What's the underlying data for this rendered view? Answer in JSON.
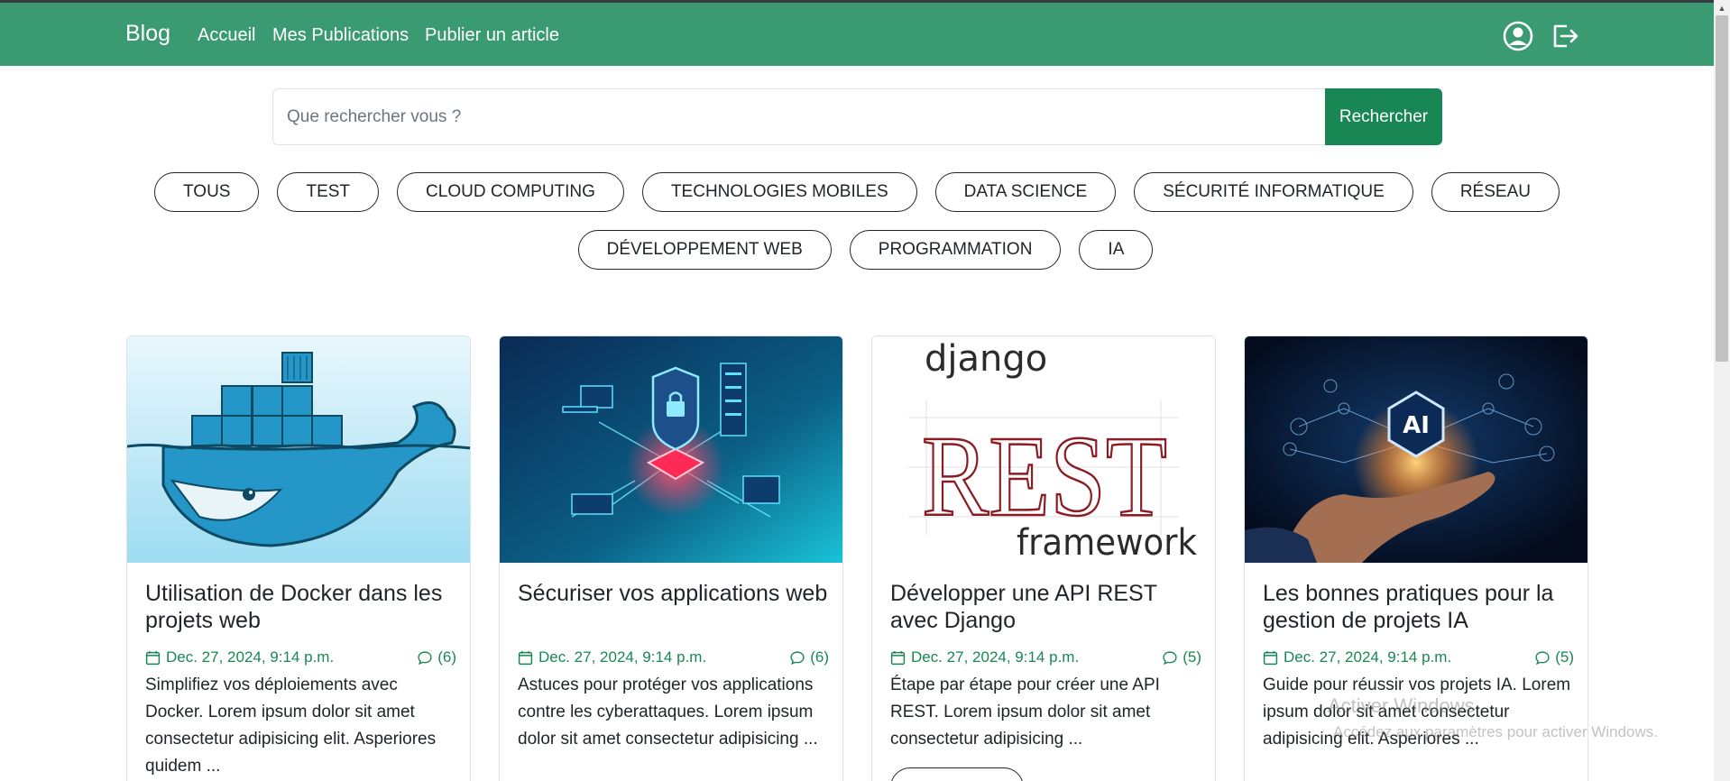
{
  "navbar": {
    "brand": "Blog",
    "links": [
      "Accueil",
      "Mes Publications",
      "Publier un article"
    ],
    "icons": [
      "user-circle-icon",
      "logout-icon"
    ],
    "background": "#3a9a72"
  },
  "search": {
    "placeholder": "Que rechercher vous ?",
    "value": "",
    "button_label": "Rechercher",
    "button_color": "#198754"
  },
  "categories": {
    "row1": [
      "TOUS",
      "TEST",
      "CLOUD COMPUTING",
      "TECHNOLOGIES MOBILES",
      "DATA SCIENCE",
      "SÉCURITÉ INFORMATIQUE",
      "RÉSEAU"
    ],
    "row2": [
      "DÉVELOPPEMENT WEB",
      "PROGRAMMATION",
      "IA"
    ]
  },
  "articles": [
    {
      "image": "docker-whale-logo",
      "title": "Utilisation de Docker dans les projets web",
      "date": "Dec. 27, 2024, 9:14 p.m.",
      "comments": "(6)",
      "description": "Simplifiez vos déploiements avec Docker. Lorem ipsum dolor sit amet consectetur adipisicing elit. Asperiores quidem ..."
    },
    {
      "image": "cybersecurity-illustration",
      "title": "Sécuriser vos applications web",
      "date": "Dec. 27, 2024, 9:14 p.m.",
      "comments": "(6)",
      "description": "Astuces pour protéger vos applications contre les cyberattaques. Lorem ipsum dolor sit amet consectetur adipisicing ..."
    },
    {
      "image": "django-rest-framework-logo",
      "image_text": {
        "top": "django",
        "middle": "REST",
        "bottom": "framework"
      },
      "title": "Développer une API REST avec Django",
      "date": "Dec. 27, 2024, 9:14 p.m.",
      "comments": "(5)",
      "description": "Étape par étape pour créer une API REST. Lorem ipsum dolor sit amet consectetur adipisicing ..."
    },
    {
      "image": "ai-hand-illustration",
      "image_text": "AI",
      "title": "Les bonnes pratiques pour la gestion de projets IA",
      "date": "Dec. 27, 2024, 9:14 p.m.",
      "comments": "(5)",
      "description": "Guide pour réussir vos projets IA. Lorem ipsum dolor sit amet consectetur adipisicing elit. Asperiores ..."
    }
  ],
  "watermark": {
    "line1": "Activer Windows",
    "line2": "Accédez aux paramètres pour activer Windows."
  }
}
